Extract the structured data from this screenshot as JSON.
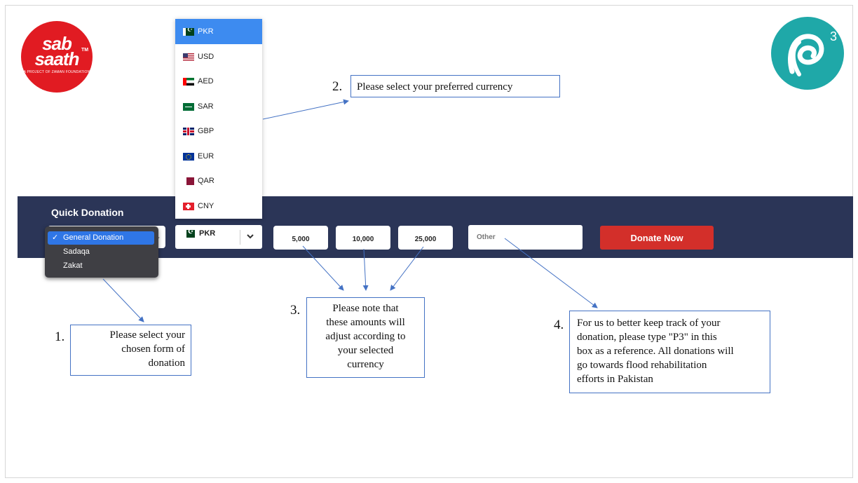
{
  "logos": {
    "sab_saath": {
      "line1": "sab",
      "line2": "saath",
      "tm": "TM",
      "tagline": "A PROJECT OF ZAMAN FOUNDATION"
    },
    "p3": {
      "superscript": "3"
    }
  },
  "currency_dropdown": {
    "items": [
      {
        "code": "PKR",
        "flag": "pakistan-flag",
        "selected": true
      },
      {
        "code": "USD",
        "flag": "usa-flag"
      },
      {
        "code": "AED",
        "flag": "uae-flag"
      },
      {
        "code": "SAR",
        "flag": "saudi-flag"
      },
      {
        "code": "GBP",
        "flag": "uk-flag"
      },
      {
        "code": "EUR",
        "flag": "eu-flag"
      },
      {
        "code": "QAR",
        "flag": "qatar-flag"
      },
      {
        "code": "CNY",
        "flag": "swiss-flag"
      }
    ]
  },
  "donation_bar": {
    "title": "Quick Donation",
    "type_menu": {
      "options": [
        {
          "label": "General Donation",
          "selected": true
        },
        {
          "label": "Sadaqa"
        },
        {
          "label": "Zakat"
        }
      ]
    },
    "currency_select": {
      "value": "PKR"
    },
    "amounts": [
      "5,000",
      "10,000",
      "25,000"
    ],
    "other_placeholder": "Other",
    "donate_label": "Donate Now",
    "colors": {
      "bar": "#2b3557",
      "donate": "#d32f2a",
      "selection": "#3d8bf0"
    }
  },
  "callouts": {
    "c1": {
      "number": "1.",
      "lines": [
        "Please select your",
        "chosen form of",
        "donation"
      ]
    },
    "c2": {
      "number": "2.",
      "text": "Please select your preferred currency"
    },
    "c3": {
      "number": "3.",
      "lines": [
        "Please note that",
        "these amounts will",
        "adjust according to",
        "your selected",
        "currency"
      ]
    },
    "c4": {
      "number": "4.",
      "lines": [
        "For us to better keep track of your",
        "donation, please type \"P3\" in this",
        "box as a reference. All donations will",
        "go towards flood rehabilitation",
        "efforts in Pakistan"
      ]
    }
  }
}
